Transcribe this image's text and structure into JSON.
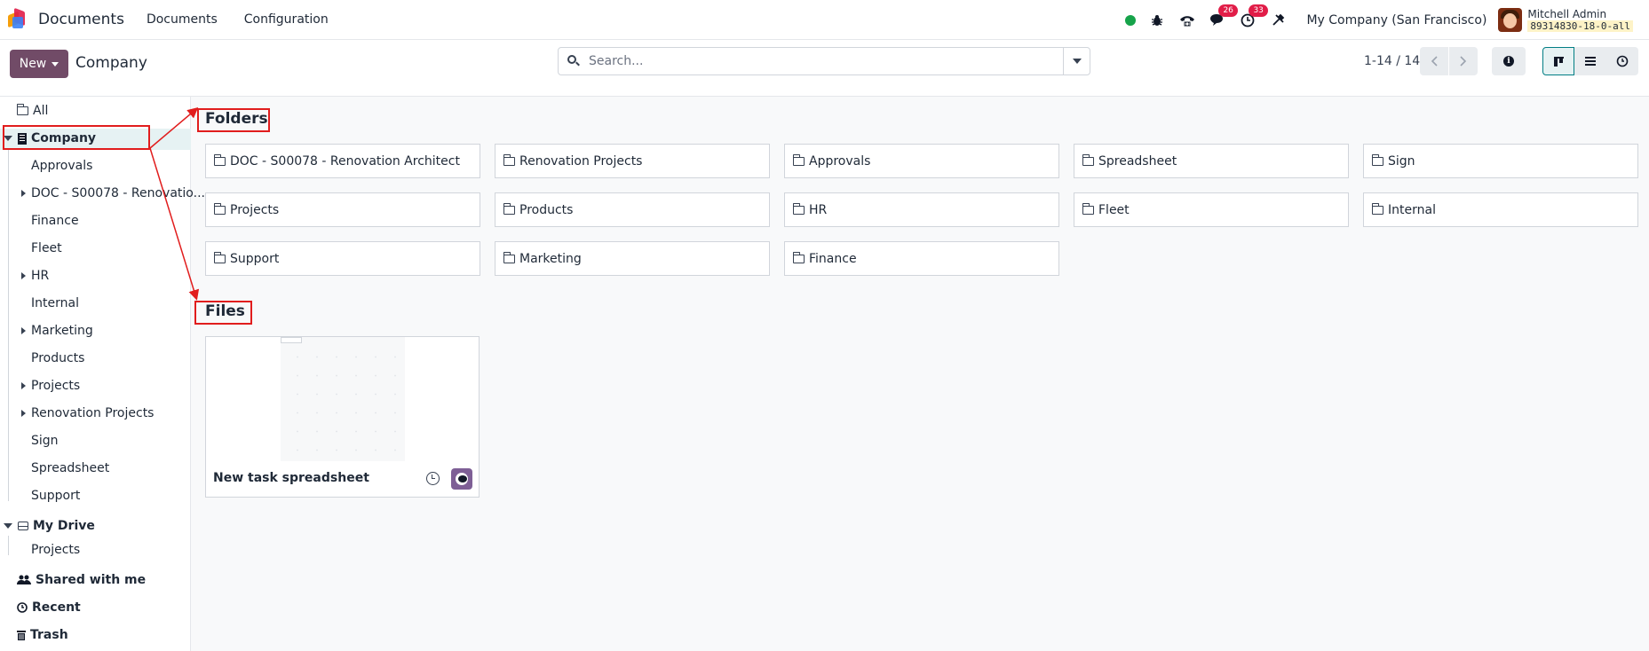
{
  "navbar": {
    "app_name": "Documents",
    "menus": [
      "Documents",
      "Configuration"
    ],
    "discuss_count": "26",
    "activity_count": "33",
    "company": "My Company (San Francisco)",
    "user_name": "Mitchell Admin",
    "database": "89314830-18-0-all"
  },
  "control": {
    "new_label": "New",
    "title": "Company",
    "search_placeholder": "Search...",
    "pager": "1-14 / 14"
  },
  "sidebar": {
    "all": "All",
    "company": "Company",
    "company_children": [
      {
        "label": "Approvals",
        "expandable": false
      },
      {
        "label": "DOC - S00078 - Renovatio...",
        "expandable": true
      },
      {
        "label": "Finance",
        "expandable": false
      },
      {
        "label": "Fleet",
        "expandable": false
      },
      {
        "label": "HR",
        "expandable": true
      },
      {
        "label": "Internal",
        "expandable": false
      },
      {
        "label": "Marketing",
        "expandable": true
      },
      {
        "label": "Products",
        "expandable": false
      },
      {
        "label": "Projects",
        "expandable": true
      },
      {
        "label": "Renovation Projects",
        "expandable": true
      },
      {
        "label": "Sign",
        "expandable": false
      },
      {
        "label": "Spreadsheet",
        "expandable": false
      },
      {
        "label": "Support",
        "expandable": false
      }
    ],
    "my_drive": "My Drive",
    "my_drive_children": [
      "Projects"
    ],
    "shared": "Shared with me",
    "recent": "Recent",
    "trash": "Trash"
  },
  "main": {
    "folders_title": "Folders",
    "files_title": "Files",
    "folders": [
      "DOC - S00078 - Renovation Architect",
      "Renovation Projects",
      "Approvals",
      "Spreadsheet",
      "Sign",
      "Projects",
      "Products",
      "HR",
      "Fleet",
      "Internal",
      "Support",
      "Marketing",
      "Finance"
    ],
    "files": [
      {
        "name": "New task spreadsheet"
      }
    ]
  },
  "colors": {
    "brand": "#714b67",
    "annotation": "#e11d1d",
    "selected": "#e6f2f3",
    "badge": "#e11d48"
  }
}
